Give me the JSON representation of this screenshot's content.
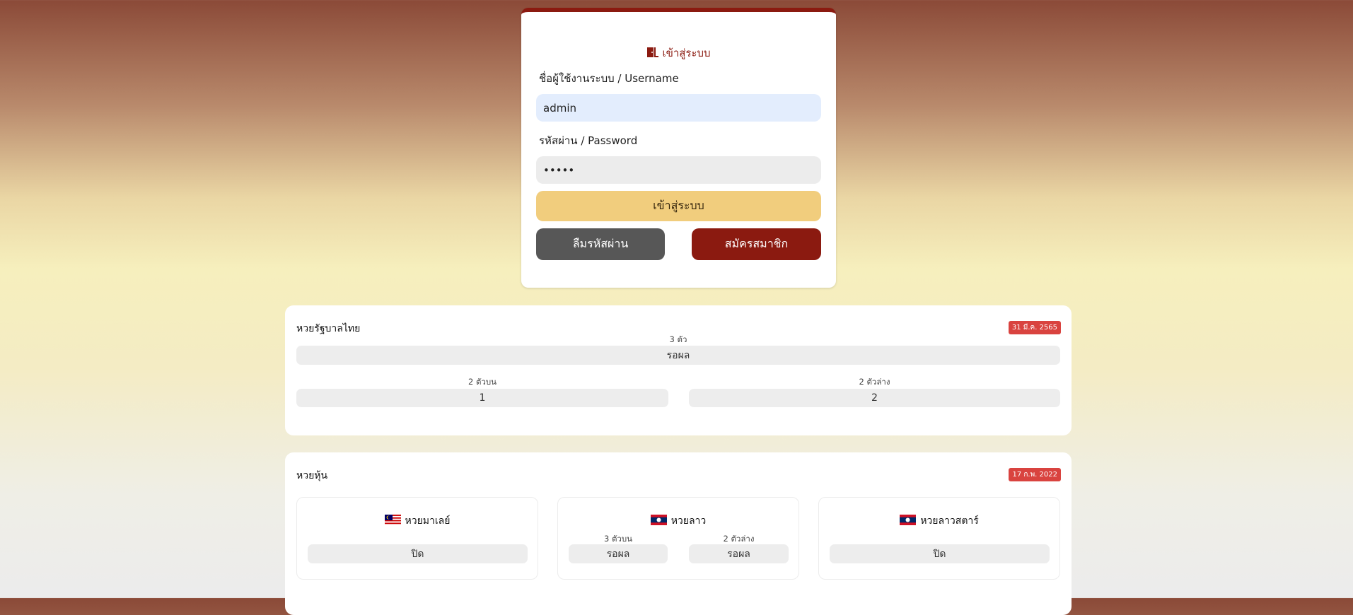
{
  "login": {
    "title": "เข้าสู่ระบบ",
    "username_label": "ชื่อผู้ใช้งานระบบ / Username",
    "username_value": "admin",
    "password_label": "รหัสผ่าน / Password",
    "password_value": "•••••",
    "login_button": "เข้าสู่ระบบ",
    "forgot_button": "ลืมรหัสผ่าน",
    "register_button": "สมัครสมาชิก",
    "colors": {
      "accent": "#8b1a10",
      "login_btn": "#f1cd7d",
      "forgot_btn": "#575757"
    }
  },
  "thai_gov": {
    "title": "หวยรัฐบาลไทย",
    "date": "31 มี.ค. 2565",
    "three_digit_label": "3 ตัว",
    "three_digit_value": "รอผล",
    "two_top_label": "2 ตัวบน",
    "two_top_value": "1",
    "two_bottom_label": "2 ตัวล่าง",
    "two_bottom_value": "2"
  },
  "stock": {
    "title": "หวยหุ้น",
    "date": "17 ก.พ. 2022",
    "cards": [
      {
        "name": "หวยมาเลย์",
        "flag": "malaysia-flag-icon",
        "status": "ปิด"
      },
      {
        "name": "หวยลาว",
        "flag": "laos-flag-icon",
        "three_top_label": "3 ตัวบน",
        "three_top_value": "รอผล",
        "two_bottom_label": "2 ตัวล่าง",
        "two_bottom_value": "รอผล"
      },
      {
        "name": "หวยลาวสตาร์",
        "flag": "laos-flag-icon",
        "status": "ปิด"
      }
    ]
  }
}
